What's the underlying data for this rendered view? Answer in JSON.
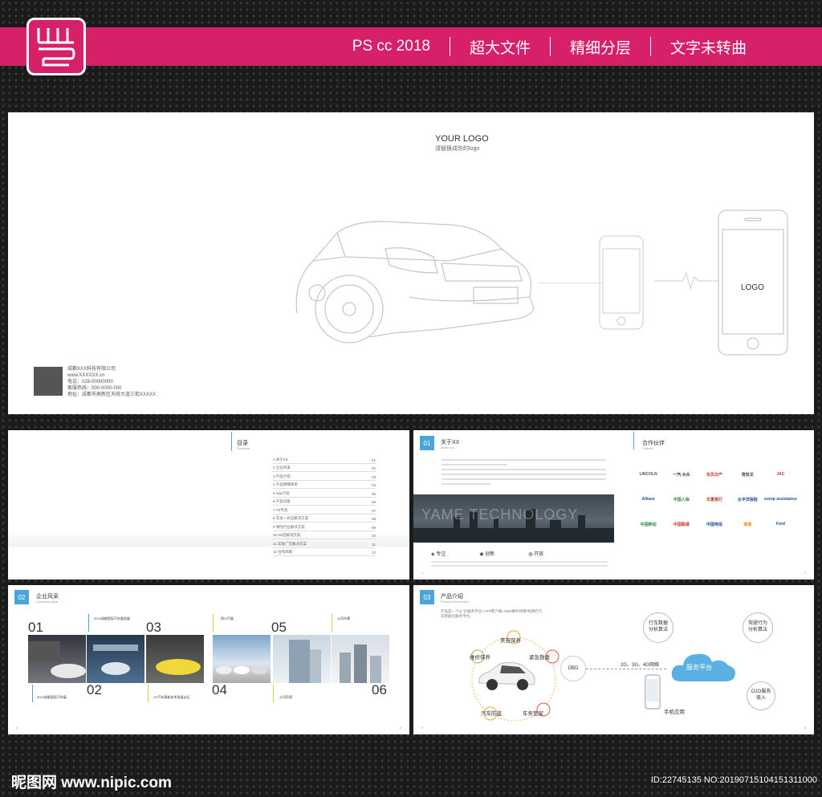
{
  "header": {
    "items": [
      "PS cc 2018",
      "超大文件",
      "精细分层",
      "文字未转曲"
    ]
  },
  "cover": {
    "logo_title": "YOUR LOGO",
    "logo_sub": "请替换成你的logo",
    "phone_logo": "LOGO",
    "company": "成都XXX科技有限公司",
    "site": "www.XXXXXX.cn",
    "phone": "电话：028-00000000",
    "hotline": "客服热线：000-0000-000",
    "address": "地址：成都市高新区天府大道三街XXXXX"
  },
  "toc": {
    "title": "目录",
    "subtitle": "Contents",
    "rows": [
      "关于XX",
      "企业风采",
      "产品介绍",
      "产品明细清单",
      "App介绍",
      "产品功能",
      "TS平台",
      "车主一对应解决方案",
      "保险行业解决方案",
      "4S店解决方案",
      "车联广告解决方案",
      "合作商家"
    ],
    "pages": [
      "01",
      "02",
      "03",
      "04",
      "05",
      "06",
      "07",
      "08",
      "09",
      "10",
      "11",
      "12"
    ]
  },
  "about": {
    "num": "01",
    "title": "关于XX",
    "subtitle": "About XX",
    "banner": "YAME TECHNOLOGY",
    "values": [
      "专注",
      "创新",
      "开放"
    ],
    "partners_title": "合作伙伴",
    "partners_sub": "Partner",
    "partners": [
      "LINCOLN",
      "一汽·大众",
      "东风日产",
      "雪铁龙",
      "JAC",
      "Allianz",
      "中国人保",
      "华夏银行",
      "太平洋保险",
      "europ assistance",
      "中国移动",
      "中国联通",
      "中国电信",
      "滴滴",
      "Ford"
    ],
    "page_left": "1",
    "page_right": "2"
  },
  "style": {
    "num": "02",
    "title": "企业风采",
    "subtitle": "Corporate style",
    "captions": [
      "2012成都国际汽车展览展",
      "2010成都国际汽车展",
      "XX汽车高新技术发展论坛",
      "四川汽展",
      "公司外景",
      "公司环境"
    ],
    "nums": [
      "01",
      "02",
      "03",
      "04",
      "05",
      "06"
    ],
    "page_left": "3",
    "page_right": "4"
  },
  "product": {
    "num": "03",
    "title": "产品介绍",
    "subtitle": "Product Description",
    "intro": "产品是一个以“云服务平台+APP客户端+OBD硬件终端”构建的汽车智能化服务平台。",
    "ring": [
      "美容保养",
      "紧急救援",
      "车务管家",
      "汽车防盗",
      "维修保养"
    ],
    "obd": "OBD",
    "network": "2G、3G、4G网络",
    "platform": "服务平台",
    "nodes": [
      "行车数据分析算法",
      "驾驶行为分析算法",
      "O2O服务接入",
      "手机应用"
    ],
    "page_left": "5",
    "page_right": "6"
  },
  "footer": {
    "site": "昵图网 www.nipic.com",
    "id": "ID:22745135 NO:20190715104151311000"
  },
  "colors": {
    "accent": "#d6206a",
    "blue": "#4aa6d8"
  }
}
